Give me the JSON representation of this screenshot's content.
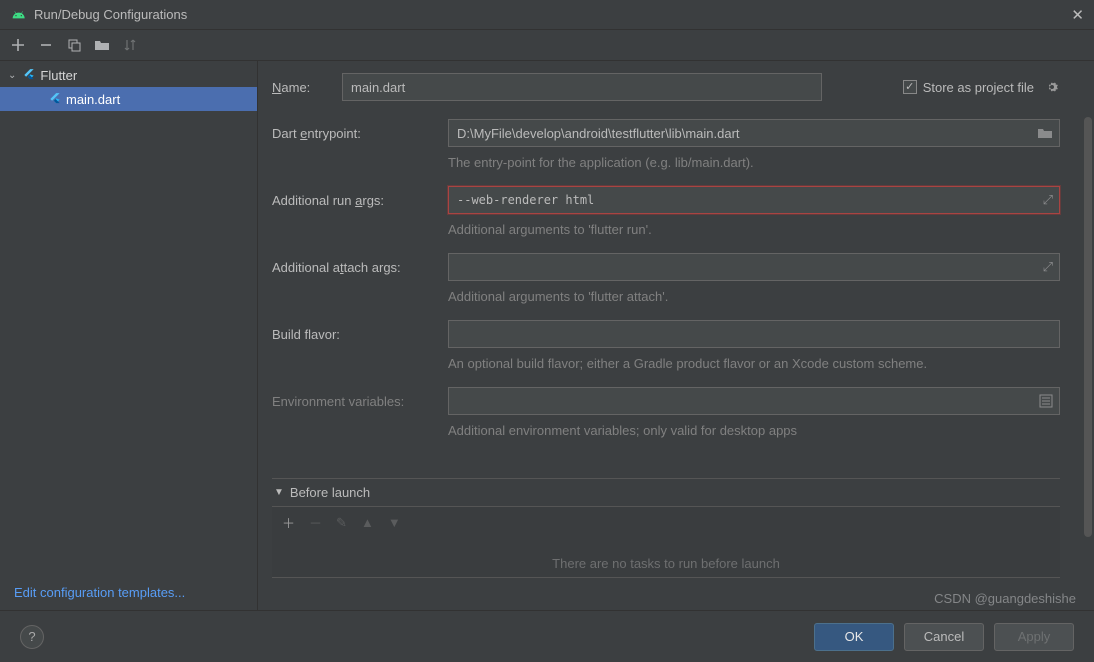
{
  "window": {
    "title": "Run/Debug Configurations"
  },
  "sidebar": {
    "root": "Flutter",
    "child": "main.dart",
    "edit_templates": "Edit configuration templates..."
  },
  "form": {
    "name_label": "Name:",
    "name_value": "main.dart",
    "store_label": "Store as project file",
    "entrypoint_label": "Dart entrypoint:",
    "entrypoint_value": "D:\\MyFile\\develop\\android\\testflutter\\lib\\main.dart",
    "entrypoint_hint": "The entry-point for the application (e.g. lib/main.dart).",
    "runargs_label": "Additional run args:",
    "runargs_value": "--web-renderer html",
    "runargs_hint": "Additional arguments to 'flutter run'.",
    "attachargs_label": "Additional attach args:",
    "attachargs_value": "",
    "attachargs_hint": "Additional arguments to 'flutter attach'.",
    "flavor_label": "Build flavor:",
    "flavor_value": "",
    "flavor_hint": "An optional build flavor; either a Gradle product flavor or an Xcode custom scheme.",
    "env_label": "Environment variables:",
    "env_value": "",
    "env_hint": "Additional environment variables; only valid for desktop apps",
    "before_launch_label": "Before launch",
    "before_launch_empty": "There are no tasks to run before launch"
  },
  "footer": {
    "ok": "OK",
    "cancel": "Cancel",
    "apply": "Apply"
  },
  "watermark": "CSDN @guangdeshishe"
}
